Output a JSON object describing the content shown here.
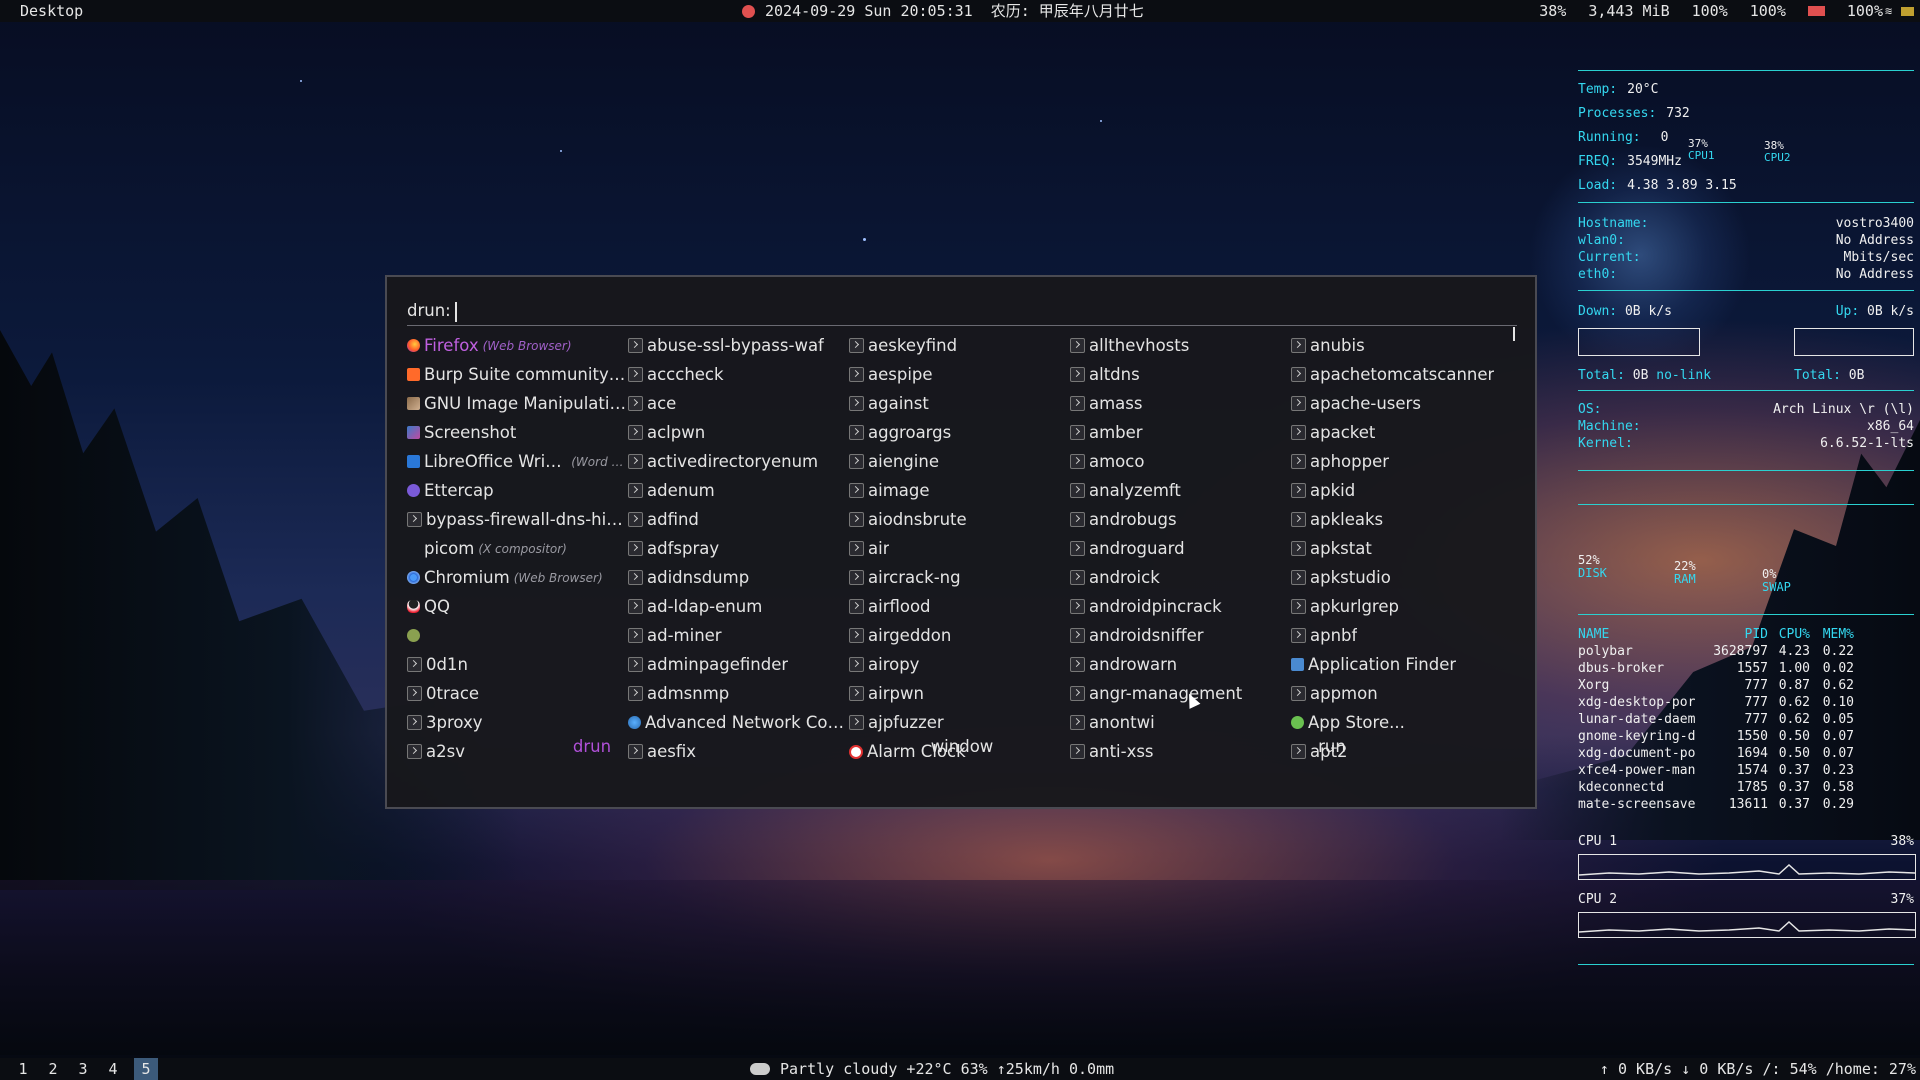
{
  "topbar": {
    "workspace_title": "Desktop",
    "datetime": "2024-09-29 Sun 20:05:31",
    "lunar_date": "农历: 甲辰年八月廿七",
    "cpu": "38%",
    "memory": "3,443 MiB",
    "brightness": "100%",
    "volume": "100%",
    "battery": "100%"
  },
  "bottombar": {
    "workspaces": [
      "1",
      "2",
      "3",
      "4",
      "5"
    ],
    "active_workspace": "5",
    "weather": "Partly cloudy  +22°C 63% ↑25km/h 0.0mm",
    "network_disk": "↑ 0 KB/s ↓ 0 KB/s  /: 54% /home: 27%"
  },
  "conky": {
    "temp_label": "Temp:",
    "temp_value": "20°C",
    "processes_label": "Processes:",
    "processes_value": "732",
    "running_label": "Running:",
    "running_value": "0",
    "freq_label": "FREQ:",
    "freq_value": "3549MHz",
    "load_label": "Load:",
    "load_value": "4.38 3.89 3.15",
    "cpu1_pct": "37%",
    "cpu1_label": "CPU1",
    "cpu2_pct": "38%",
    "cpu2_label": "CPU2",
    "hostname_label": "Hostname:",
    "hostname_value": "vostro3400",
    "wlan_label": "wlan0:",
    "wlan_value": "No Address",
    "current_label": "Current:",
    "current_value": "Mbits/sec",
    "eth_label": "eth0:",
    "eth_value": "No Address",
    "down_label": "Down:",
    "down_value": "0B k/s",
    "up_label": "Up:",
    "up_value": "0B k/s",
    "total_down_label": "Total:",
    "total_down_value": "0B",
    "total_down_status": "no-link",
    "total_up_label": "Total:",
    "total_up_value": "0B",
    "os_label": "OS:",
    "os_value": "Arch Linux \\r (\\l)",
    "machine_label": "Machine:",
    "machine_value": "x86_64",
    "kernel_label": "Kernel:",
    "kernel_value": "6.6.52-1-lts",
    "disk_pct": "52%",
    "disk_label": "DISK",
    "ram_pct": "22%",
    "ram_label": "RAM",
    "swap_pct": "0%",
    "swap_label": "SWAP",
    "proc_headers": [
      "NAME",
      "PID",
      "CPU%",
      "MEM%"
    ],
    "processes": [
      {
        "name": "polybar",
        "pid": "3628797",
        "cpu": "4.23",
        "mem": "0.22"
      },
      {
        "name": "dbus-broker",
        "pid": "1557",
        "cpu": "1.00",
        "mem": "0.02"
      },
      {
        "name": "Xorg",
        "pid": "777",
        "cpu": "0.87",
        "mem": "0.62"
      },
      {
        "name": "xdg-desktop-por",
        "pid": "777",
        "cpu": "0.62",
        "mem": "0.10"
      },
      {
        "name": "lunar-date-daem",
        "pid": "777",
        "cpu": "0.62",
        "mem": "0.05"
      },
      {
        "name": "gnome-keyring-d",
        "pid": "1550",
        "cpu": "0.50",
        "mem": "0.07"
      },
      {
        "name": "xdg-document-po",
        "pid": "1694",
        "cpu": "0.50",
        "mem": "0.07"
      },
      {
        "name": "xfce4-power-man",
        "pid": "1574",
        "cpu": "0.37",
        "mem": "0.23"
      },
      {
        "name": "kdeconnectd",
        "pid": "1785",
        "cpu": "0.37",
        "mem": "0.58"
      },
      {
        "name": "mate-screensave",
        "pid": "13611",
        "cpu": "0.37",
        "mem": "0.29"
      }
    ],
    "cpu1_graph_label": "CPU 1",
    "cpu1_graph_value": "38%",
    "cpu2_graph_label": "CPU 2",
    "cpu2_graph_value": "37%"
  },
  "rofi": {
    "prompt": "drun:",
    "modes": [
      "drun",
      "window",
      "run"
    ],
    "active_mode": "drun",
    "columns": [
      [
        {
          "name": "Firefox",
          "sub": "(Web Browser)",
          "icon": "firefox"
        },
        {
          "name": "Burp Suite community e...",
          "icon": "burp"
        },
        {
          "name": "GNU Image Manipulatio...",
          "icon": "gimp"
        },
        {
          "name": "Screenshot",
          "icon": "shot"
        },
        {
          "name": "LibreOffice Writer",
          "sub": "(Word P...",
          "icon": "writer"
        },
        {
          "name": "Ettercap",
          "icon": "ettercap"
        },
        {
          "name": "bypass-firewall-dns-hist...",
          "icon": "term"
        },
        {
          "name": "picom",
          "sub": "(X compositor)",
          "icon": "blank"
        },
        {
          "name": "Chromium",
          "sub": "(Web Browser)",
          "icon": "chromium"
        },
        {
          "name": "QQ",
          "icon": "qq"
        },
        {
          "name": "",
          "icon": "misc"
        },
        {
          "name": "0d1n",
          "icon": "term"
        },
        {
          "name": "0trace",
          "icon": "term"
        },
        {
          "name": "3proxy",
          "icon": "term"
        },
        {
          "name": "a2sv",
          "icon": "term"
        }
      ],
      [
        {
          "name": "abuse-ssl-bypass-waf",
          "icon": "term"
        },
        {
          "name": "acccheck",
          "icon": "term"
        },
        {
          "name": "ace",
          "icon": "term"
        },
        {
          "name": "aclpwn",
          "icon": "term"
        },
        {
          "name": "activedirectoryenum",
          "icon": "term"
        },
        {
          "name": "adenum",
          "icon": "term"
        },
        {
          "name": "adfind",
          "icon": "term"
        },
        {
          "name": "adfspray",
          "icon": "term"
        },
        {
          "name": "adidnsdump",
          "icon": "term"
        },
        {
          "name": "ad-ldap-enum",
          "icon": "term"
        },
        {
          "name": "ad-miner",
          "icon": "term"
        },
        {
          "name": "adminpagefinder",
          "icon": "term"
        },
        {
          "name": "admsnmp",
          "icon": "term"
        },
        {
          "name": "Advanced Network Con...",
          "icon": "network"
        },
        {
          "name": "aesfix",
          "icon": "term"
        }
      ],
      [
        {
          "name": "aeskeyfind",
          "icon": "term"
        },
        {
          "name": "aespipe",
          "icon": "term"
        },
        {
          "name": "against",
          "icon": "term"
        },
        {
          "name": "aggroargs",
          "icon": "term"
        },
        {
          "name": "aiengine",
          "icon": "term"
        },
        {
          "name": "aimage",
          "icon": "term"
        },
        {
          "name": "aiodnsbrute",
          "icon": "term"
        },
        {
          "name": "air",
          "icon": "term"
        },
        {
          "name": "aircrack-ng",
          "icon": "term"
        },
        {
          "name": "airflood",
          "icon": "term"
        },
        {
          "name": "airgeddon",
          "icon": "term"
        },
        {
          "name": "airopy",
          "icon": "term"
        },
        {
          "name": "airpwn",
          "icon": "term"
        },
        {
          "name": "ajpfuzzer",
          "icon": "term"
        },
        {
          "name": "Alarm Clock",
          "icon": "clock"
        }
      ],
      [
        {
          "name": "allthevhosts",
          "icon": "term"
        },
        {
          "name": "altdns",
          "icon": "term"
        },
        {
          "name": "amass",
          "icon": "term"
        },
        {
          "name": "amber",
          "icon": "term"
        },
        {
          "name": "amoco",
          "icon": "term"
        },
        {
          "name": "analyzemft",
          "icon": "term"
        },
        {
          "name": "androbugs",
          "icon": "term"
        },
        {
          "name": "androguard",
          "icon": "term"
        },
        {
          "name": "androick",
          "icon": "term"
        },
        {
          "name": "androidpincrack",
          "icon": "term"
        },
        {
          "name": "androidsniffer",
          "icon": "term"
        },
        {
          "name": "androwarn",
          "icon": "term"
        },
        {
          "name": "angr-management",
          "icon": "term"
        },
        {
          "name": "anontwi",
          "icon": "term"
        },
        {
          "name": "anti-xss",
          "icon": "term"
        }
      ],
      [
        {
          "name": "anubis",
          "icon": "term"
        },
        {
          "name": "apachetomcatscanner",
          "icon": "term"
        },
        {
          "name": "apache-users",
          "icon": "term"
        },
        {
          "name": "apacket",
          "icon": "term"
        },
        {
          "name": "aphopper",
          "icon": "term"
        },
        {
          "name": "apkid",
          "icon": "term"
        },
        {
          "name": "apkleaks",
          "icon": "term"
        },
        {
          "name": "apkstat",
          "icon": "term"
        },
        {
          "name": "apkstudio",
          "icon": "term"
        },
        {
          "name": "apkurlgrep",
          "icon": "term"
        },
        {
          "name": "apnbf",
          "icon": "term"
        },
        {
          "name": "Application Finder",
          "icon": "finder"
        },
        {
          "name": "appmon",
          "icon": "term"
        },
        {
          "name": "App Store...",
          "icon": "store"
        },
        {
          "name": "apt2",
          "icon": "term"
        }
      ]
    ]
  }
}
